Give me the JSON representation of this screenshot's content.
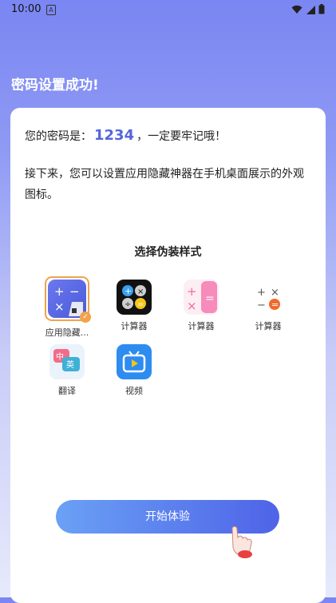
{
  "status_bar": {
    "time": "10:00",
    "notif_icon": "A"
  },
  "page_title": "密码设置成功!",
  "password": {
    "prefix": "您的密码是：",
    "value": "1234",
    "suffix": "，一定要牢记哦！"
  },
  "description": "接下来，您可以设置应用隐藏神器在手机桌面展示的外观图标。",
  "section_title": "选择伪装样式",
  "icons": [
    {
      "label": "应用隐藏...",
      "icon": "calculator-purple-icon",
      "selected": true
    },
    {
      "label": "计算器",
      "icon": "calculator-black-icon"
    },
    {
      "label": "计算器",
      "icon": "calculator-pink-icon"
    },
    {
      "label": "计算器",
      "icon": "calculator-white-icon"
    },
    {
      "label": "翻译",
      "icon": "translate-icon"
    },
    {
      "label": "视频",
      "icon": "video-tv-icon"
    }
  ],
  "start_button": "开始体验",
  "colors": {
    "accent": "#5565d9",
    "selected_border": "#f0a34a"
  }
}
